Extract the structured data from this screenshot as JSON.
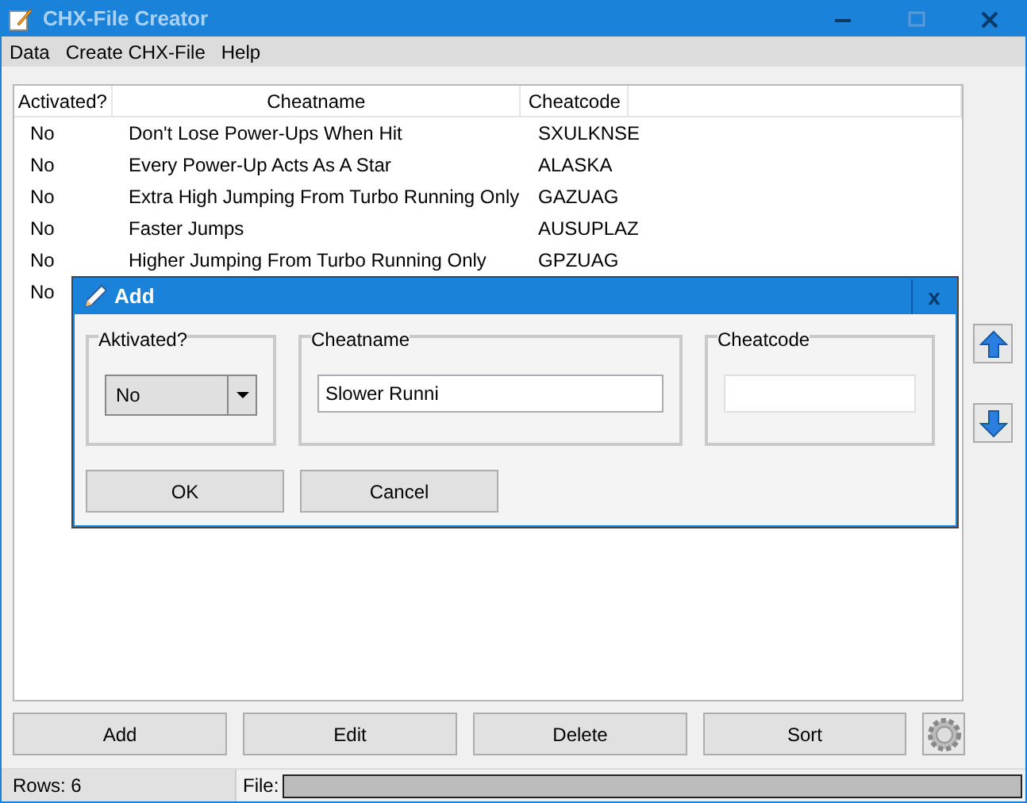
{
  "window": {
    "title": "CHX-File Creator"
  },
  "menu": [
    "Data",
    "Create CHX-File",
    "Help"
  ],
  "table": {
    "columns": [
      "Activated?",
      "Cheatname",
      "Cheatcode"
    ],
    "rows": [
      {
        "activated": "No",
        "cheatname": "Don't Lose Power-Ups When Hit",
        "cheatcode": "SXULKNSE"
      },
      {
        "activated": "No",
        "cheatname": "Every Power-Up Acts As A Star",
        "cheatcode": "ALASKA"
      },
      {
        "activated": "No",
        "cheatname": "Extra High Jumping From Turbo Running Only",
        "cheatcode": "GAZUAG"
      },
      {
        "activated": "No",
        "cheatname": "Faster Jumps",
        "cheatcode": "AUSUPLAZ"
      },
      {
        "activated": "No",
        "cheatname": "Higher Jumping From Turbo Running Only",
        "cheatcode": "GPZUAG"
      },
      {
        "activated": "No"
      }
    ]
  },
  "buttons": [
    "Add",
    "Edit",
    "Delete",
    "Sort"
  ],
  "status_bar": {
    "rows": "Rows: 6",
    "file_label": "File:"
  },
  "dialog": {
    "title": "Add",
    "close": "x",
    "groups": [
      {
        "kind": "combo",
        "label": "Aktivated?",
        "value": "No"
      },
      {
        "kind": "text",
        "label": "Cheatname",
        "value": "Slower Runni"
      },
      {
        "kind": "text",
        "label": "Cheatcode"
      }
    ],
    "buttons": [
      "OK",
      "Cancel"
    ]
  }
}
